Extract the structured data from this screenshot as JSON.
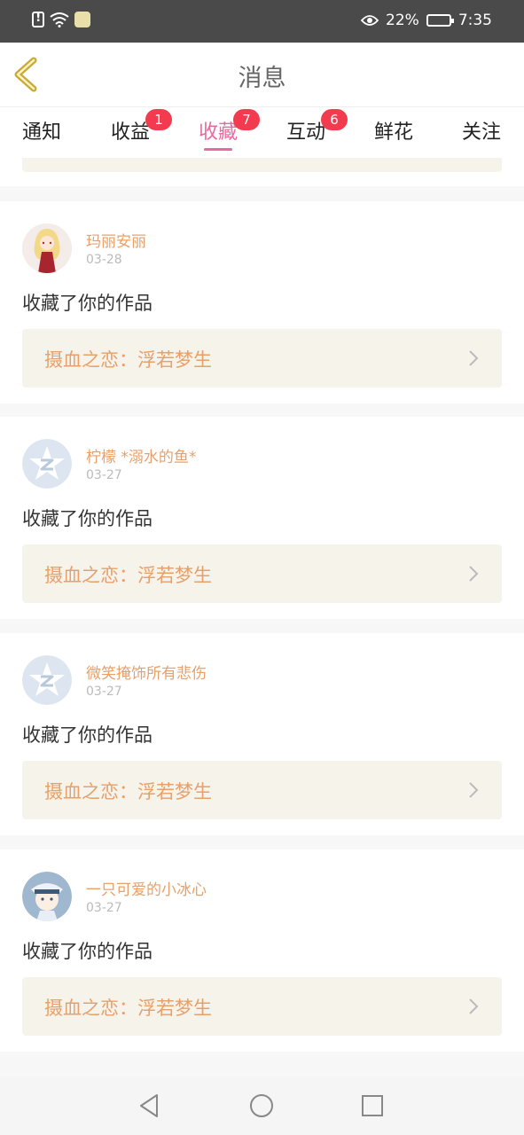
{
  "status": {
    "battery": "22%",
    "time": "7:35"
  },
  "header": {
    "title": "消息"
  },
  "tabs": [
    {
      "label": "通知",
      "badge": ""
    },
    {
      "label": "收益",
      "badge": "1"
    },
    {
      "label": "收藏",
      "badge": "7",
      "active": true
    },
    {
      "label": "互动",
      "badge": "6"
    },
    {
      "label": "鲜花",
      "badge": ""
    },
    {
      "label": "关注",
      "badge": ""
    }
  ],
  "items": [
    {
      "name": "玛丽安丽",
      "date": "03-28",
      "action": "收藏了你的作品",
      "work": "摄血之恋：浮若梦生",
      "avatar": "avatar-girl-red-dress"
    },
    {
      "name": "柠檬 *溺水的鱼*",
      "date": "03-27",
      "action": "收藏了你的作品",
      "work": "摄血之恋：浮若梦生",
      "avatar": "avatar-default-star"
    },
    {
      "name": "微笑掩饰所有悲伤",
      "date": "03-27",
      "action": "收藏了你的作品",
      "work": "摄血之恋：浮若梦生",
      "avatar": "avatar-default-star"
    },
    {
      "name": "一只可爱的小冰心",
      "date": "03-27",
      "action": "收藏了你的作品",
      "work": "摄血之恋：浮若梦生",
      "avatar": "avatar-boy-hat"
    }
  ],
  "colors": {
    "accent": "#e86aa0",
    "badge": "#f23b4e",
    "name": "#e8a06a",
    "card_bg": "#f5f3ea"
  }
}
